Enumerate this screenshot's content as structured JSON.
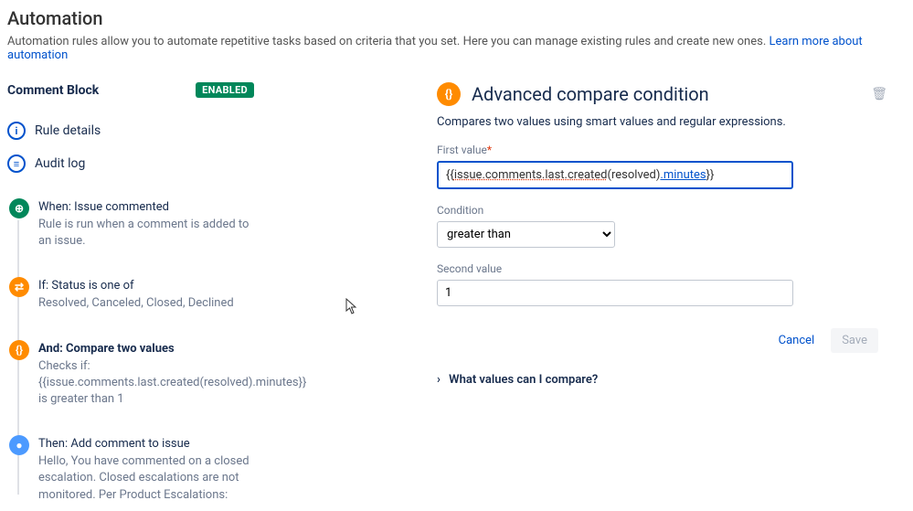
{
  "header": {
    "title": "Automation",
    "description": "Automation rules allow you to automate repetitive tasks based on criteria that you set. Here you can manage existing rules and create new ones.",
    "learnMore": "Learn more about automation"
  },
  "sidebar": {
    "ruleName": "Comment Block",
    "statusBadge": "ENABLED",
    "nav": [
      {
        "icon": "i",
        "label": "Rule details"
      },
      {
        "icon": "≡",
        "label": "Audit log"
      }
    ],
    "chain": [
      {
        "color": "green",
        "glyph": "⊕",
        "title": "When: Issue commented",
        "bold": false,
        "sub": "Rule is run when a comment is added to an issue."
      },
      {
        "color": "orange",
        "glyph": "⇄",
        "title": "If: Status is one of",
        "bold": false,
        "sub": "Resolved, Canceled, Closed, Declined"
      },
      {
        "color": "orange",
        "glyph": "{}",
        "title": "And: Compare two values",
        "bold": true,
        "sub": "Checks if:\n{{issue.comments.last.created(resolved).minutes}} is greater than 1"
      },
      {
        "color": "blue",
        "glyph": "●",
        "title": "Then: Add comment to issue",
        "bold": false,
        "sub": "Hello, You have commented on a closed escalation. Closed escalations are not monitored. Per Product Escalations:"
      }
    ]
  },
  "panel": {
    "icon": "{}",
    "title": "Advanced compare condition",
    "desc": "Compares two values using smart values and regular expressions.",
    "firstValueLabel": "First value",
    "firstValue": "{{issue.comments.last.created(resolved).minutes}}",
    "conditionLabel": "Condition",
    "condition": "greater than",
    "secondValueLabel": "Second value",
    "secondValue": "1",
    "cancel": "Cancel",
    "save": "Save",
    "expander": "What values can I compare?"
  }
}
